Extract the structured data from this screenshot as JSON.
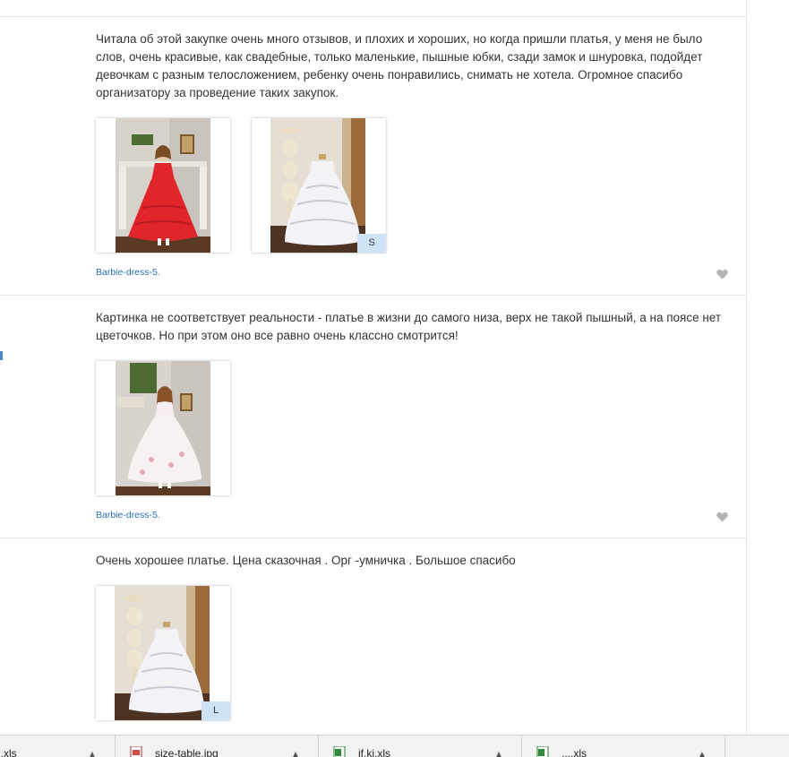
{
  "reviews": [
    {
      "text": "Читала об этой закупке очень много отзывов, и плохих и хороших, но когда пришли платья, у меня не было слов, очень красивые, как свадебные, только маленькие, пышные юбки, сзади замок и шнуровка, подойдет девочкам с разным телосложением, ребенку очень понравились, снимать не хотела. Огромное спасибо организатору за проведение таких закупок.",
      "photos": [
        {
          "subject": "girl-red-dress-photo"
        },
        {
          "subject": "white-dress-mannequin-photo",
          "size_badge": "S"
        }
      ],
      "product_link": "Barbie-dress-5."
    },
    {
      "text": "Картинка не соответствует реальности - платье в жизни до самого низа, верх не такой пышный, а на поясе нет цветочков. Но при этом оно все равно очень классно смотрится!",
      "photos": [
        {
          "subject": "girl-white-dress-photo"
        }
      ],
      "product_link": "Barbie-dress-5."
    },
    {
      "text": "Очень хорошее платье. Цена сказочная . Орг -умничка . Большое спасибо",
      "photos": [
        {
          "subject": "white-dress-mannequin-photo",
          "size_badge": "L"
        }
      ]
    }
  ],
  "icons": {
    "like": "heart-icon",
    "download_chevron": "chevron-up-icon",
    "image_file": "image-file-icon",
    "excel_file": "excel-file-icon"
  },
  "colors": {
    "link": "#2a6ebb",
    "badge": "#cfe3f7",
    "like": "#b5b5b5",
    "red_dress": "#e0262b"
  },
  "download_bar": {
    "items": [
      {
        "name": "...xls"
      },
      {
        "name": "size-table.jpg"
      },
      {
        "name": "jf.ki.xls"
      },
      {
        "name": "....xls"
      }
    ]
  }
}
